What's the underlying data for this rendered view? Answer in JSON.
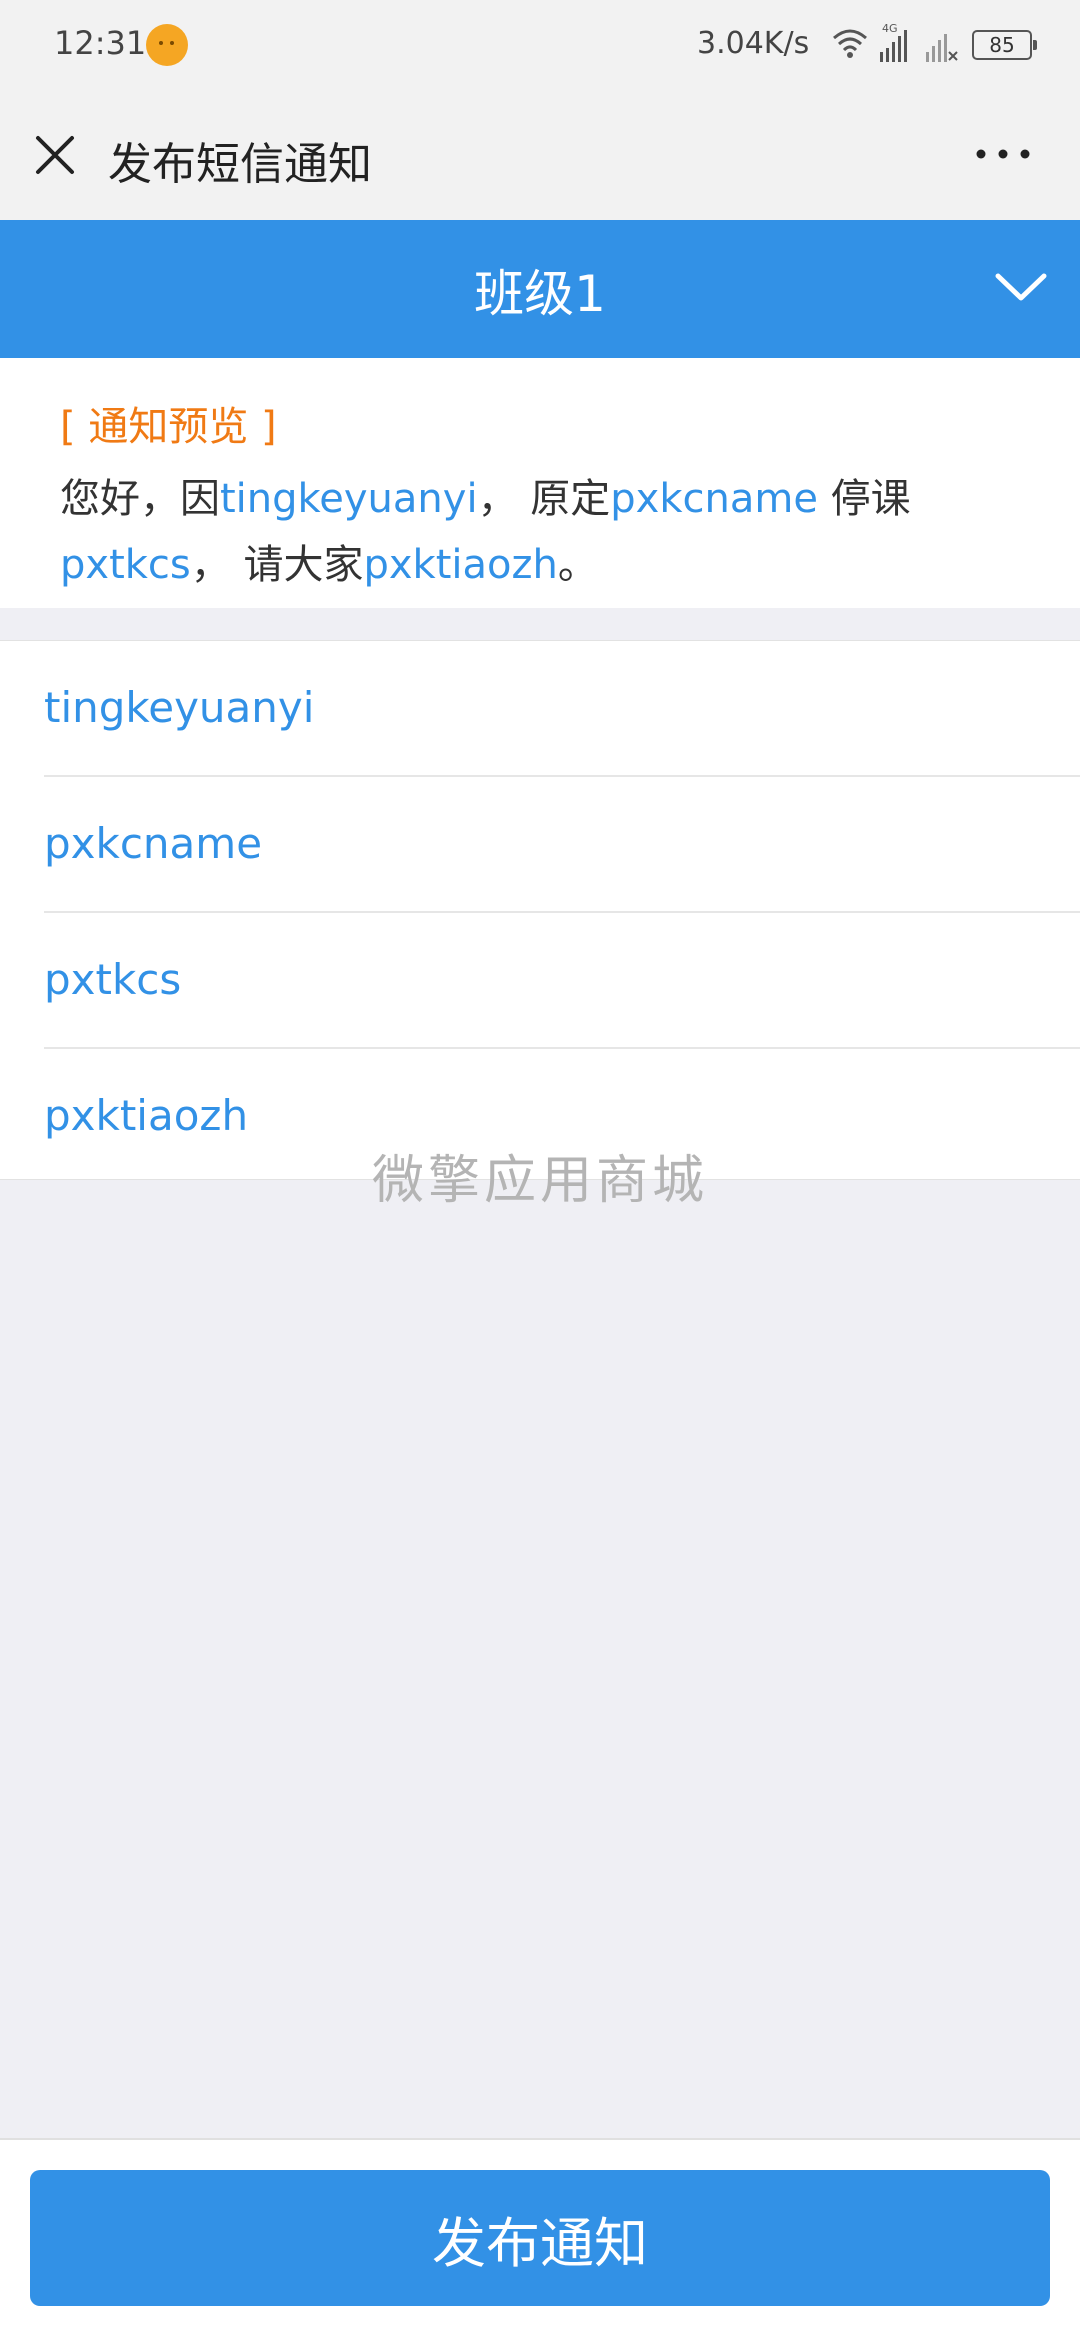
{
  "status_bar": {
    "time": "12:31",
    "net_speed": "3.04K/s",
    "network": "4G",
    "battery": "85"
  },
  "header": {
    "title": "发布短信通知"
  },
  "class_selector": {
    "selected": "班级1"
  },
  "preview": {
    "label": "[ 通知预览 ]",
    "t1": "您好，因",
    "v1": "tingkeyuanyi",
    "t2": "， 原定",
    "v2": "pxkcname",
    "t3": " 停课",
    "v3": "pxtkcs",
    "t4": "， 请大家",
    "v4": "pxktiaozh",
    "t5": "。"
  },
  "variables": [
    "tingkeyuanyi",
    "pxkcname",
    "pxtkcs",
    "pxktiaozh"
  ],
  "watermark": "微擎应用商城",
  "footer": {
    "publish_label": "发布通知"
  },
  "colors": {
    "accent": "#3291e6",
    "preview_label": "#f07a14"
  }
}
